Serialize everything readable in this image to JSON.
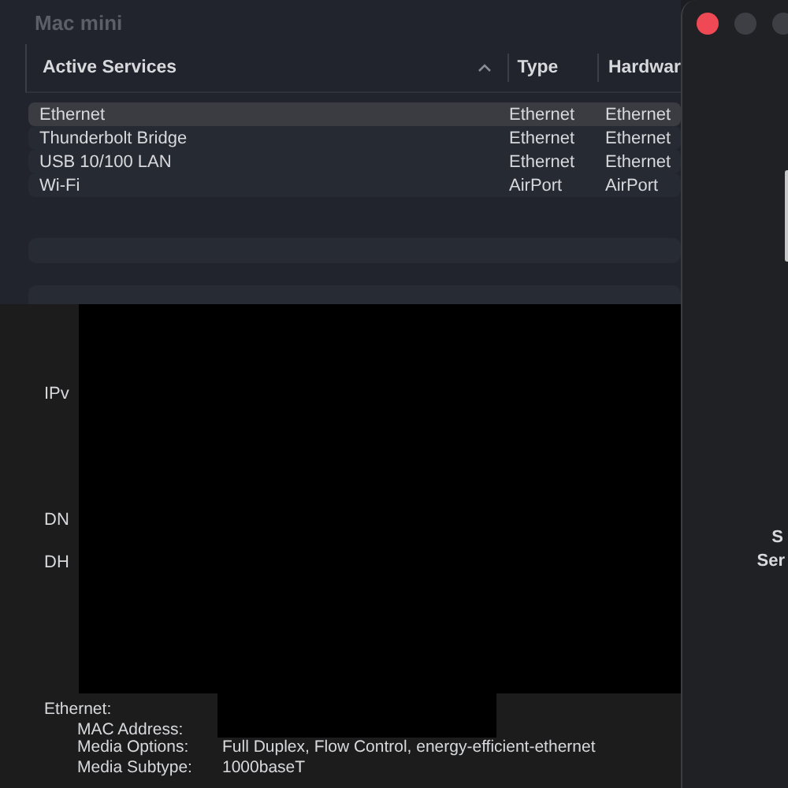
{
  "window": {
    "title": "Mac mini"
  },
  "table": {
    "columns": [
      {
        "label": "Active Services",
        "sorted": true
      },
      {
        "label": "Type",
        "sorted": false
      },
      {
        "label": "Hardwar",
        "sorted": false
      }
    ],
    "rows": [
      {
        "cells": [
          "Ethernet",
          "Ethernet",
          "Ethernet"
        ],
        "selected": true
      },
      {
        "cells": [
          "Thunderbolt Bridge",
          "Ethernet",
          "Ethernet"
        ],
        "selected": false
      },
      {
        "cells": [
          "USB 10/100 LAN",
          "Ethernet",
          "Ethernet"
        ],
        "selected": false
      },
      {
        "cells": [
          "Wi-Fi",
          "AirPort",
          "AirPort"
        ],
        "selected": false
      }
    ]
  },
  "details": {
    "labels": [
      "IPv",
      "DN",
      "DH"
    ],
    "section": "Ethernet:",
    "fields": [
      {
        "label": "MAC Address:"
      },
      {
        "label": "Media Options:",
        "value": "Full Duplex, Flow Control, energy-efficient-ethernet"
      },
      {
        "label": "Media Subtype:",
        "value": "1000baseT"
      }
    ]
  },
  "side_window": {
    "lines": [
      "S",
      "Ser"
    ]
  }
}
